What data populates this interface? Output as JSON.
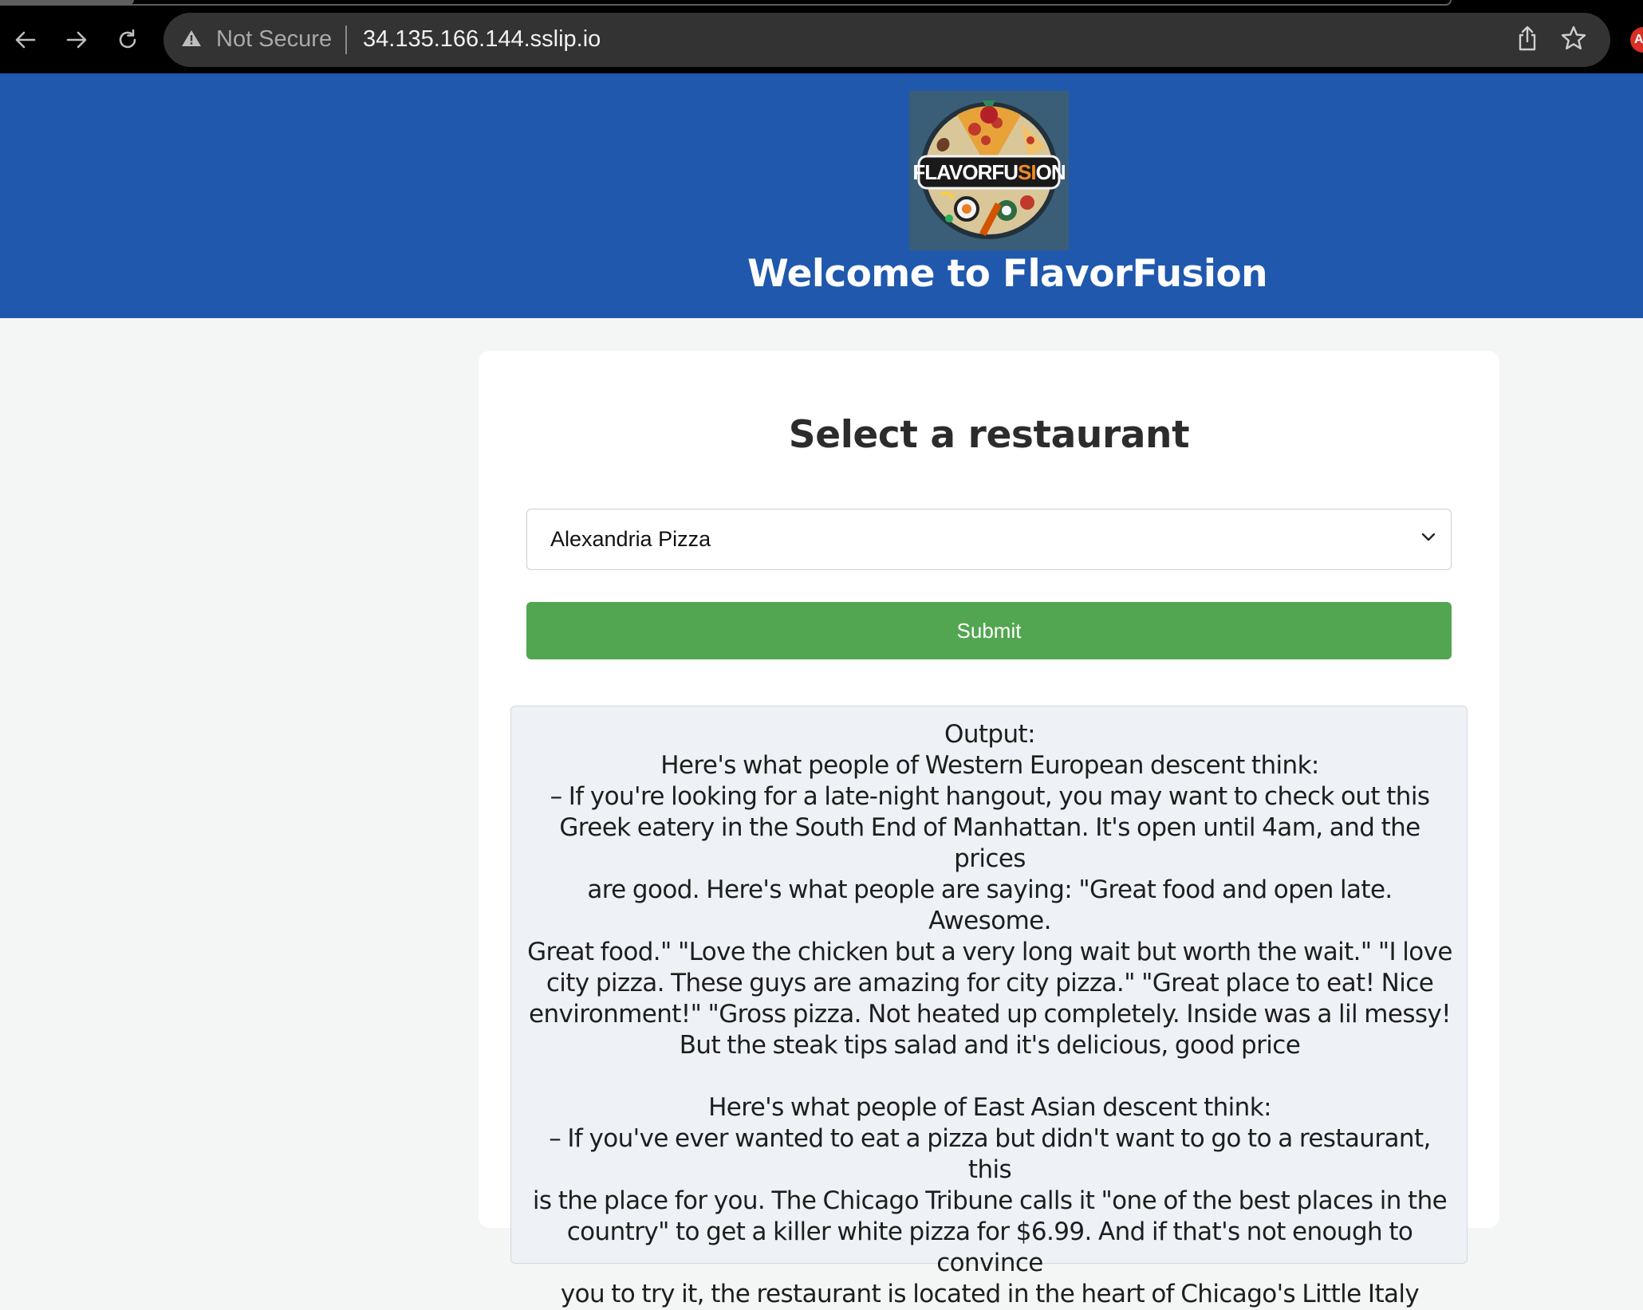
{
  "browser": {
    "security_label": "Not Secure",
    "url": "34.135.166.144.sslip.io",
    "extension_badge": "A"
  },
  "header": {
    "logo_text": "FLAVORFUSION",
    "title": "Welcome to FlavorFusion",
    "background_color": "#1f58ad"
  },
  "form": {
    "heading": "Select a restaurant",
    "selected_restaurant": "Alexandria Pizza",
    "submit_label": "Submit",
    "submit_color": "#52a551"
  },
  "output": {
    "label": "Output:",
    "sections": [
      {
        "heading": "Here's what people of Western European descent think:",
        "lines": [
          "– If you're looking for a late-night hangout, you may want to check out this",
          "Greek eatery in the South End of Manhattan. It's open until 4am, and the prices",
          "are good. Here's what people are saying: \"Great food and open late. Awesome.",
          "Great food.\" \"Love the chicken but a very long wait but worth the wait.\" \"I love",
          "city pizza. These guys are amazing for city pizza.\" \"Great place to eat! Nice",
          "environment!\" \"Gross pizza. Not heated up completely. Inside was a lil messy!",
          "But the steak tips salad and it's delicious, good price"
        ]
      },
      {
        "heading": "Here's what people of East Asian descent think:",
        "lines": [
          "– If you've ever wanted to eat a pizza but didn't want to go to a restaurant, this",
          "is the place for you. The Chicago Tribune calls it \"one of the best places in the",
          "country\" to get a killer white pizza for $6.99. And if that's not enough to convince",
          "you to try it, the restaurant is located in the heart of Chicago's Little Italy"
        ]
      }
    ]
  }
}
